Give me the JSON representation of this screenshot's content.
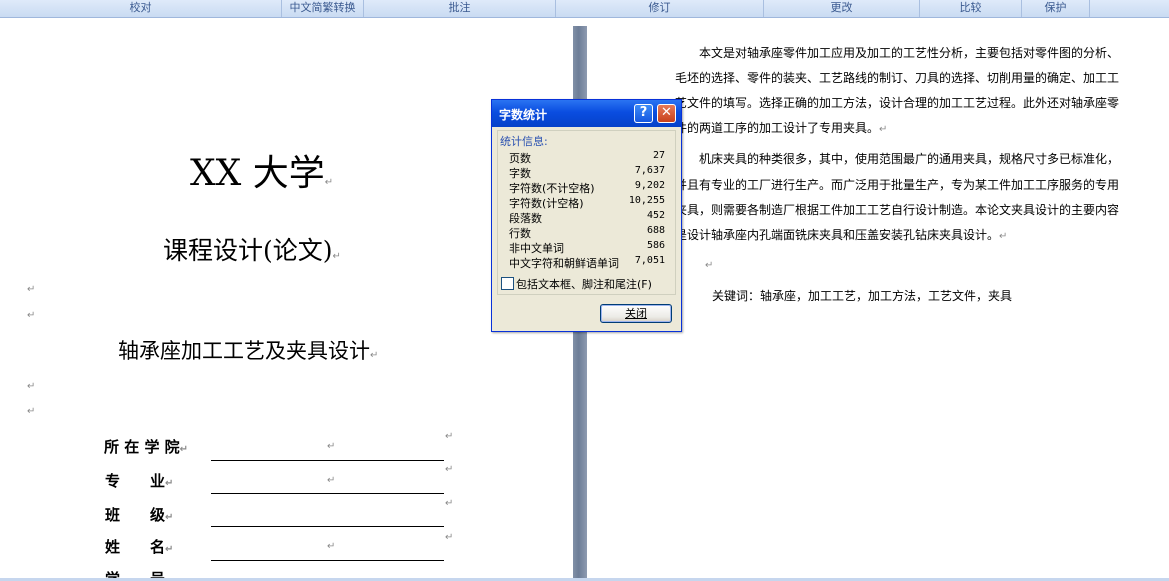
{
  "ribbon": {
    "groups": [
      "校对",
      "中文简繁转换",
      "批注",
      "修订",
      "更改",
      "比较",
      "保护"
    ]
  },
  "left_page": {
    "university": "XX 大学",
    "course": "课程设计(论文)",
    "topic": "轴承座加工工艺及夹具设计",
    "fields": {
      "college": "所 在 学 院",
      "major": "专　　业",
      "class": "班　　级",
      "name": "姓　　名",
      "partial": "学　　号"
    }
  },
  "right_page": {
    "lines": [
      "　　本文是对轴承座零件加工应用及加工的工艺性分析，主要包括对零件图的分析、",
      "毛坯的选择、零件的装夹、工艺路线的制订、刀具的选择、切削用量的确定、加工工",
      "艺文件的填写。选择正确的加工方法，设计合理的加工工艺过程。此外还对轴承座零",
      "件的两道工序的加工设计了专用夹具。",
      "　　机床夹具的种类很多，其中，使用范围最广的通用夹具，规格尺寸多已标准化，",
      "并且有专业的工厂进行生产。而广泛用于批量生产，专为某工件加工工序服务的专用",
      "夹具，则需要各制造厂根据工件加工工艺自行设计制造。本论文夹具设计的主要内容",
      "是设计轴承座内孔端面铣床夹具和压盖安装孔钻床夹具设计。"
    ],
    "keywords": "关键词：轴承座，加工工艺，加工方法，工艺文件，夹具"
  },
  "dialog": {
    "title": "字数统计",
    "section": "统计信息:",
    "stats": [
      {
        "label": "页数",
        "value": "27"
      },
      {
        "label": "字数",
        "value": "7,637"
      },
      {
        "label": "字符数(不计空格)",
        "value": "9,202"
      },
      {
        "label": "字符数(计空格)",
        "value": "10,255"
      },
      {
        "label": "段落数",
        "value": "452"
      },
      {
        "label": "行数",
        "value": "688"
      },
      {
        "label": "非中文单词",
        "value": "586"
      },
      {
        "label": "中文字符和朝鲜语单词",
        "value": "7,051"
      }
    ],
    "checkbox_label": "包括文本框、脚注和尾注(F)",
    "close_label": "关闭",
    "help_glyph": "?",
    "close_glyph": "✕"
  },
  "para_mark": "↵"
}
